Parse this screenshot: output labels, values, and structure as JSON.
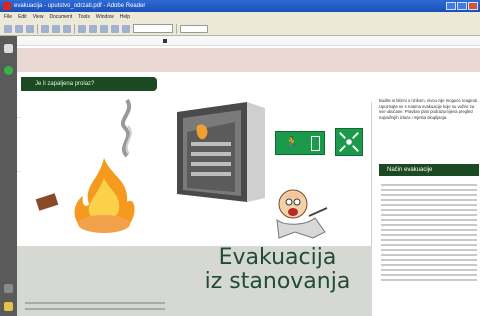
{
  "window": {
    "title": "evakuacija - uputstvo_odrzati.pdf - Adobe Reader",
    "controls": [
      "minimize",
      "maximize",
      "close"
    ]
  },
  "menu": {
    "items": [
      "File",
      "Edit",
      "View",
      "Document",
      "Tools",
      "Window",
      "Help"
    ]
  },
  "toolbar": {
    "zoom_value": ""
  },
  "document": {
    "question_label": "Je li zapaljena prolaz?",
    "left_labels": [
      "...",
      "...",
      "..."
    ],
    "right_intro": "Budite si blizini o rizikom, nivou nije moguće reagirati. Upoznajte se s rutama evakuacije koje su važne za sve ukućane. Pravilan plan podrazumijeva pregled najvažnijih izlaza i mjesta okupljanja.",
    "section_title": "Način evakuacije",
    "big_title_line1": "Evakuacija",
    "big_title_line2": "iz stanovanja",
    "footer_left": "",
    "footer_mid": ""
  },
  "icons": {
    "app": "adobe-reader-icon",
    "exit": "emergency-exit-icon",
    "assembly": "assembly-point-icon"
  },
  "colors": {
    "titlebar": "#1b4fb8",
    "dark_green": "#1b4a22",
    "exit_green": "#1a9a4a",
    "band_pink": "#e9d8d3",
    "big_text": "#224b35"
  }
}
